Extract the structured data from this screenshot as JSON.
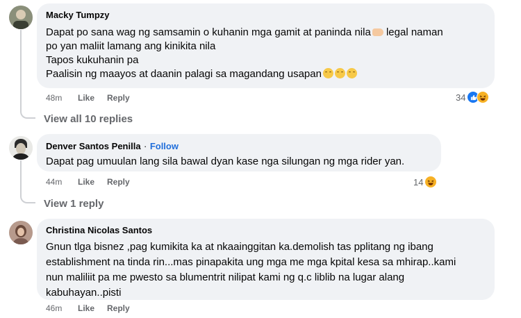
{
  "comments": [
    {
      "author": "Macky Tumpzy",
      "lines": [
        "Dapat po sana wag ng samsamin o kuhanin mga gamit at paninda nila",
        "po yan maliit lamang ang kinikita nila",
        "Tapos kukuhanin pa",
        "Paalisin ng maayos at daanin palagi sa magandang usapan"
      ],
      "line1_suffix": " legal naman",
      "time": "48m",
      "like": "Like",
      "reply": "Reply",
      "reaction_count": "34",
      "reaction_icons": [
        "like-icon",
        "haha-icon"
      ],
      "view_replies": "View all 10 replies"
    },
    {
      "author": "Denver Santos Penilla",
      "separator": "·",
      "follow": "Follow",
      "lines": [
        "Dapat pag umuulan lang sila bawal dyan kase nga silungan ng mga rider yan."
      ],
      "time": "44m",
      "like": "Like",
      "reply": "Reply",
      "reaction_count": "14",
      "reaction_icons": [
        "haha-icon"
      ],
      "view_replies": "View 1 reply"
    },
    {
      "author": "Christina Nicolas Santos",
      "lines": [
        "Gnun tlga bisnez ,pag kumikita ka at nkaainggitan ka.demolish tas pplitang ng ibang",
        "establishment na tinda rin...mas pinapakita ung mga me mga kpital kesa sa mhirap..kami",
        "nun maliliit pa me pwesto sa blumentrit nilipat kami ng q.c liblib na lugar alang",
        "kabuhayan..pisti"
      ],
      "time": "46m",
      "like": "Like",
      "reply": "Reply"
    }
  ],
  "colors": {
    "bubble": "#f0f2f5",
    "secondary_text": "#65676b",
    "follow": "#216fdb",
    "like_reaction": "#1877f2",
    "haha_reaction": "#f7b125"
  }
}
